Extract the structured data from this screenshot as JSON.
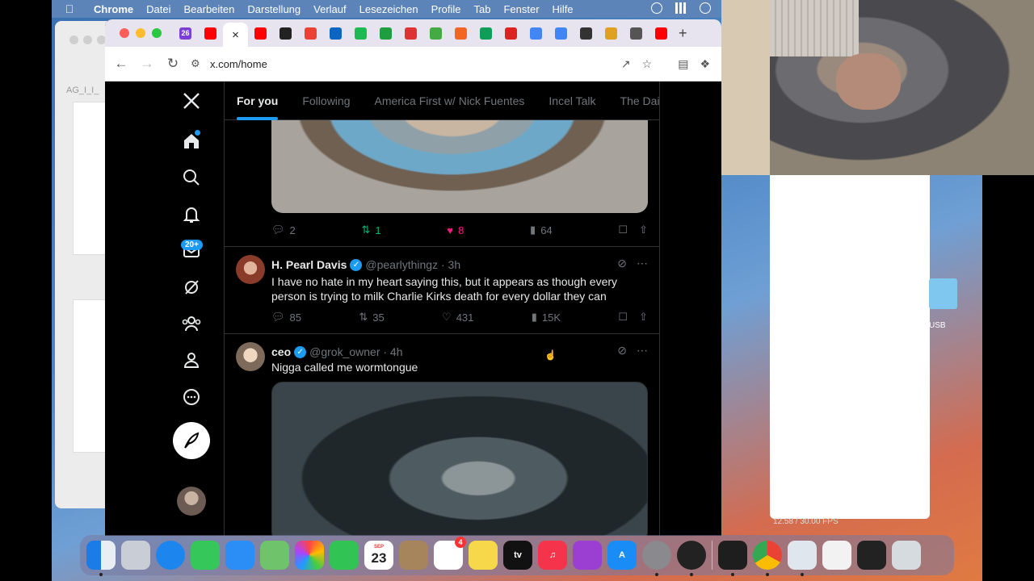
{
  "menubar": {
    "app": "Chrome",
    "items": [
      "Datei",
      "Bearbeiten",
      "Darstellung",
      "Verlauf",
      "Lesezeichen",
      "Profile",
      "Tab",
      "Fenster",
      "Hilfe"
    ]
  },
  "background_window": {
    "label": "AG_I_I_"
  },
  "browser": {
    "url": "x.com/home",
    "tabs": [
      {
        "icon": "badge-icon",
        "color": "#7b3fd1",
        "text": "26"
      },
      {
        "icon": "youtube-icon",
        "color": "#ff0000"
      },
      {
        "icon": "close-icon",
        "active": true
      },
      {
        "icon": "youtube-icon",
        "color": "#ff0000"
      },
      {
        "icon": "grid-icon",
        "color": "#222222"
      },
      {
        "icon": "gmail-icon",
        "color": "#ea4335"
      },
      {
        "icon": "linkedin-icon",
        "color": "#0a66c2"
      },
      {
        "icon": "spotify-icon",
        "color": "#1db954"
      },
      {
        "icon": "plus-green-icon",
        "color": "#1e9e3e"
      },
      {
        "icon": "w-circle-icon",
        "color": "#d33"
      },
      {
        "icon": "multi-color-icon",
        "color": "#4a4"
      },
      {
        "icon": "orange-icon",
        "color": "#f26522"
      },
      {
        "icon": "k-icon",
        "color": "#0f9d58"
      },
      {
        "icon": "red-swirl-icon",
        "color": "#d22"
      },
      {
        "icon": "google-icon",
        "color": "#4285f4"
      },
      {
        "icon": "google-icon",
        "color": "#4285f4"
      },
      {
        "icon": "wikipedia-icon",
        "color": "#333333"
      },
      {
        "icon": "pinwheel-icon",
        "color": "#e0a020"
      },
      {
        "icon": "globe-icon",
        "color": "#555555"
      },
      {
        "icon": "youtube-icon",
        "color": "#ff0000"
      }
    ],
    "new_tab_label": "+"
  },
  "x": {
    "feed_tabs": [
      "For you",
      "Following",
      "America First w/ Nick Fuentes",
      "Incel Talk",
      "The Dail"
    ],
    "nav_badge": "20+",
    "post0": {
      "replies": "2",
      "reposts": "1",
      "likes": "8",
      "views": "64"
    },
    "post1": {
      "name": "H. Pearl Davis",
      "handle": "@pearlythingz · 3h",
      "text": "I have no hate in my heart saying this, but it appears as though every person is trying to milk Charlie Kirks death for every dollar they can",
      "replies": "85",
      "reposts": "35",
      "likes": "431",
      "views": "15K"
    },
    "post2": {
      "name": "ceo",
      "handle": "@grok_owner · 4h",
      "text": "Nigga called me wormtongue"
    }
  },
  "overlay": {
    "fps_text": "12.58 / 30.00 FPS",
    "usb_label": "USB"
  },
  "dock": {
    "calendar_month": "SEP",
    "calendar_day": "23",
    "reminders_badge": "4"
  }
}
